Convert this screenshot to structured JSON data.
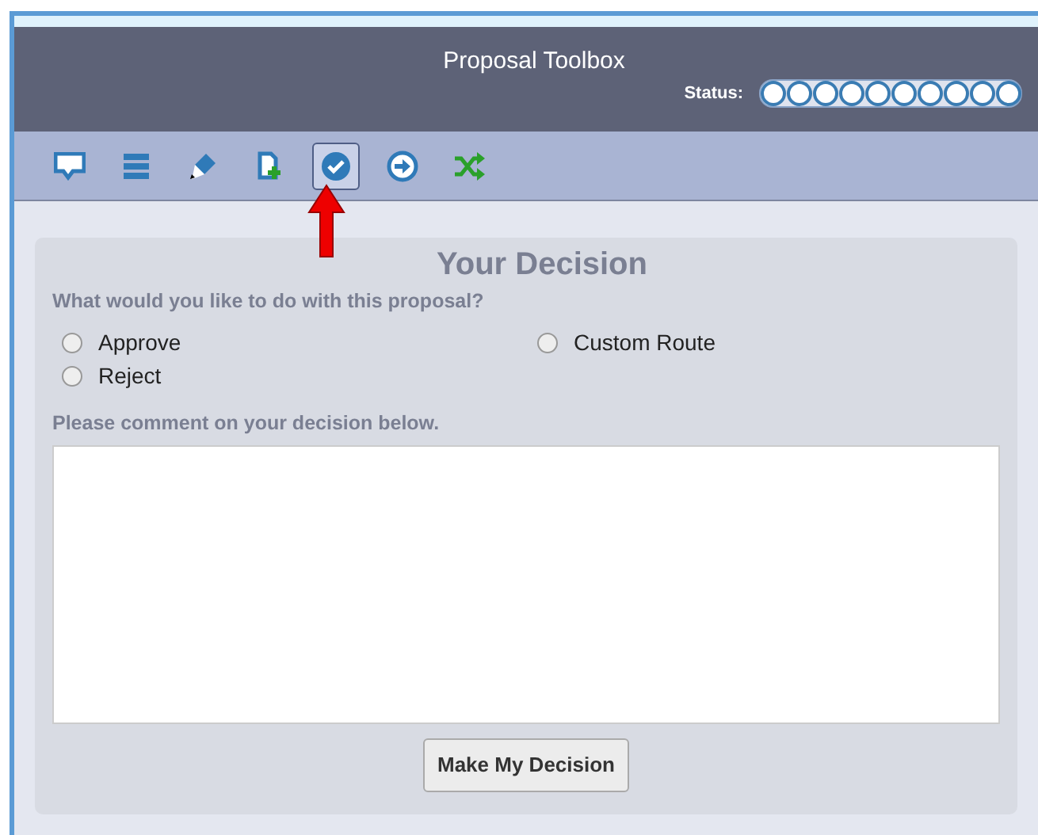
{
  "header": {
    "title": "Proposal Toolbox",
    "status_label": "Status:"
  },
  "toolbar": [
    {
      "kind": "comment",
      "selected": false
    },
    {
      "kind": "list",
      "selected": false
    },
    {
      "kind": "edit",
      "selected": false
    },
    {
      "kind": "add",
      "selected": false
    },
    {
      "kind": "check",
      "selected": true
    },
    {
      "kind": "forward",
      "selected": false
    },
    {
      "kind": "shuffle",
      "selected": false
    }
  ],
  "decision": {
    "title": "Your Decision",
    "question": "What would you like to do with this proposal?",
    "options": [
      {
        "label": "Approve",
        "selected": false
      },
      {
        "label": "Custom Route",
        "selected": false
      },
      {
        "label": "Reject",
        "selected": false
      }
    ],
    "comment_label": "Please comment on your decision below.",
    "submit": "Make My Decision"
  }
}
